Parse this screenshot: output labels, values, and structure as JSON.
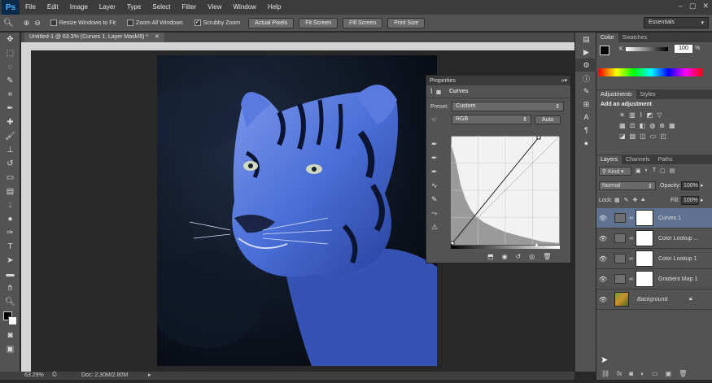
{
  "menubar": {
    "logo": "Ps",
    "items": [
      "File",
      "Edit",
      "Image",
      "Layer",
      "Type",
      "Select",
      "Filter",
      "View",
      "Window",
      "Help"
    ],
    "window_controls": [
      "–",
      "▢",
      "✕"
    ]
  },
  "options": {
    "resize_windows": "Resize Windows to Fit",
    "zoom_all": "Zoom All Windows",
    "scrubby_zoom": "Scrubby Zoom",
    "actual_pixels": "Actual Pixels",
    "fit_screen": "Fit Screen",
    "fill_screen": "Fill Screen",
    "print_size": "Print Size",
    "workspace": "Essentials"
  },
  "document": {
    "tab_title": "Untitled-1 @ 63.3% (Curves 1, Layer Mask/8) *",
    "zoom": "63.29%",
    "doc_size": "Doc: 2.30M/2.80M"
  },
  "properties": {
    "tab": "Properties",
    "title": "Curves",
    "preset_label": "Preset:",
    "preset_value": "Custom",
    "channel": "RGB",
    "auto": "Auto"
  },
  "color_panel": {
    "tabs": [
      "Color",
      "Swatches"
    ],
    "k_label": "K",
    "k_value": "100",
    "unit": "%"
  },
  "adjustments_panel": {
    "tabs": [
      "Adjustments",
      "Styles"
    ],
    "title": "Add an adjustment"
  },
  "layers_panel": {
    "tabs": [
      "Layers",
      "Channels",
      "Paths"
    ],
    "kind": "Kind",
    "blend_mode": "Normal",
    "opacity_label": "Opacity:",
    "opacity_value": "100%",
    "lock_label": "Lock:",
    "fill_label": "Fill:",
    "fill_value": "100%",
    "layers": [
      {
        "name": "Curves 1"
      },
      {
        "name": "Color Lookup ..."
      },
      {
        "name": "Color Lookup 1"
      },
      {
        "name": "Gradient Map 1"
      },
      {
        "name": "Background"
      }
    ]
  },
  "colors": {
    "accent_selected_layer": "#5f7391",
    "tiger_tint": "#4a6fd8"
  }
}
